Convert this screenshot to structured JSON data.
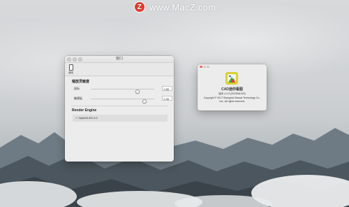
{
  "watermark": {
    "logo": "Z",
    "text": "www.MacZ.com"
  },
  "preferences_window": {
    "title": "窗口",
    "toolbar": {
      "items": [
        {
          "icon": "phone-icon",
          "label": "通用"
        }
      ]
    },
    "sensitivity": {
      "title": "缩放灵敏度",
      "sliders": [
        {
          "label": "鼠标",
          "value": "0.85",
          "level": 0.85
        },
        {
          "label": "触摸板",
          "value": "0.96",
          "level": 0.96
        }
      ]
    },
    "render_engine": {
      "title": "Render Engine",
      "options": [
        {
          "label": "✓ OpenGLES 2.0",
          "selected": true
        }
      ]
    }
  },
  "about_window": {
    "app_name": "CAD迷你看图",
    "version": "版本 4.4.3 (2023061923)",
    "copyright_line1": "Copyright © 2017 Shanghai Xiaocai Technology Co.,",
    "copyright_line2": "Ltd., All rights reserved.",
    "traffic_colors": [
      "#fe5f57",
      "#c9c9c9",
      "#c9c9c9"
    ]
  }
}
